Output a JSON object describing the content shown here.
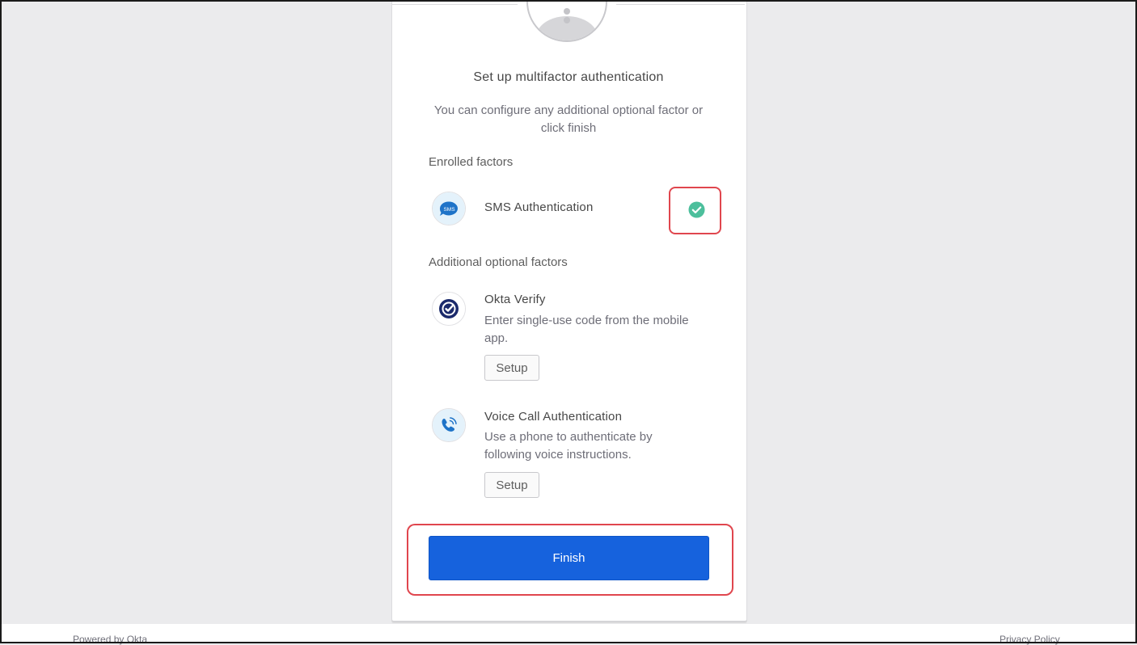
{
  "header": {
    "title": "Set up multifactor authentication",
    "subtitle": "You can configure any additional optional factor or click finish"
  },
  "enrolled": {
    "label": "Enrolled factors",
    "items": [
      {
        "name": "SMS Authentication",
        "icon": "sms-icon",
        "icon_text": "SMS",
        "status_icon": "check-circle-icon"
      }
    ]
  },
  "optional": {
    "label": "Additional optional factors",
    "items": [
      {
        "name": "Okta Verify",
        "description": "Enter single-use code from the mobile app.",
        "icon": "okta-verify-icon",
        "button": "Setup"
      },
      {
        "name": "Voice Call Authentication",
        "description": "Use a phone to authenticate by following voice instructions.",
        "icon": "voice-call-icon",
        "button": "Setup"
      }
    ]
  },
  "finish_label": "Finish",
  "footer": {
    "left": "Powered by Okta",
    "right": "Privacy Policy"
  },
  "colors": {
    "primary": "#1662dd",
    "success": "#4cbf9c",
    "highlight": "#e0464e",
    "background": "#ebebed",
    "okta_navy": "#1b2a6b",
    "sms_blue": "#1e73c8"
  }
}
